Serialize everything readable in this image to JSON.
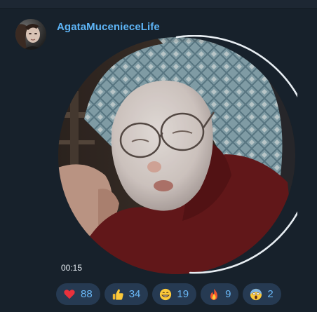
{
  "message": {
    "author": "AgataMuceniecеLife",
    "duration": "00:15"
  },
  "reactions": [
    {
      "icon": "heart-icon",
      "count": "88"
    },
    {
      "icon": "thumbs-up-icon",
      "count": "34"
    },
    {
      "icon": "grinning-face-icon",
      "count": "19"
    },
    {
      "icon": "fire-icon",
      "count": "9"
    },
    {
      "icon": "screaming-face-icon",
      "count": "2"
    }
  ],
  "colors": {
    "background": "#17212b",
    "author_name": "#5eb5f7",
    "reaction_bg": "#263a52",
    "reaction_count": "#6ab8f7"
  }
}
